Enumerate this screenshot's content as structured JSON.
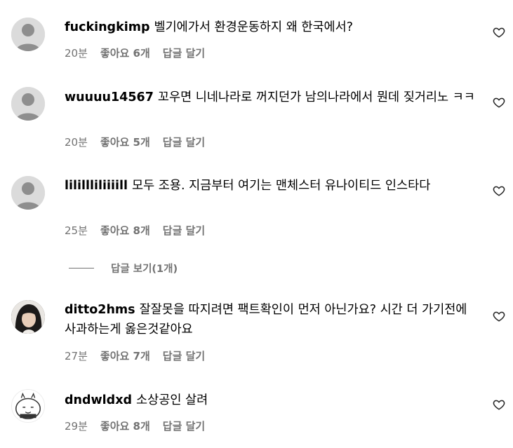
{
  "comments": [
    {
      "username": "fuckingkimp",
      "text": "벨기에가서 환경운동하지 왜 한국에서?",
      "time": "20분",
      "likes": "좋아요 6개",
      "reply": "답글 달기",
      "avatar": "default-avatar"
    },
    {
      "username": "wuuuu14567",
      "text": "꼬우면 니네나라로 꺼지던가 남의나라에서 뭔데 짖거리노 ㅋㅋ",
      "time": "20분",
      "likes": "좋아요 5개",
      "reply": "답글 달기",
      "avatar": "default-avatar"
    },
    {
      "username": "lilillliliiiill",
      "text": "모두 조용. 지금부터 여기는 맨체스터 유나이티드 인스타다",
      "time": "25분",
      "likes": "좋아요 8개",
      "reply": "답글 달기",
      "avatar": "default-avatar"
    },
    {
      "username": "ditto2hms",
      "text": "잘잘못을 따지려면 팩트확인이 먼저 아닌가요? 시간 더 가기전에 사과하는게 옳은것같아요",
      "time": "27분",
      "likes": "좋아요 7개",
      "reply": "답글 달기",
      "avatar": "photo-avatar"
    },
    {
      "username": "dndwldxd",
      "text": "소상공인 살려",
      "time": "29분",
      "likes": "좋아요 8개",
      "reply": "답글 달기",
      "avatar": "cartoon-avatar"
    }
  ],
  "view_replies": "답글 보기(1개)",
  "icons": {
    "like": "heart-icon"
  },
  "colors": {
    "secondary_text": "#737373",
    "avatar_bg": "#dbdbdb"
  }
}
